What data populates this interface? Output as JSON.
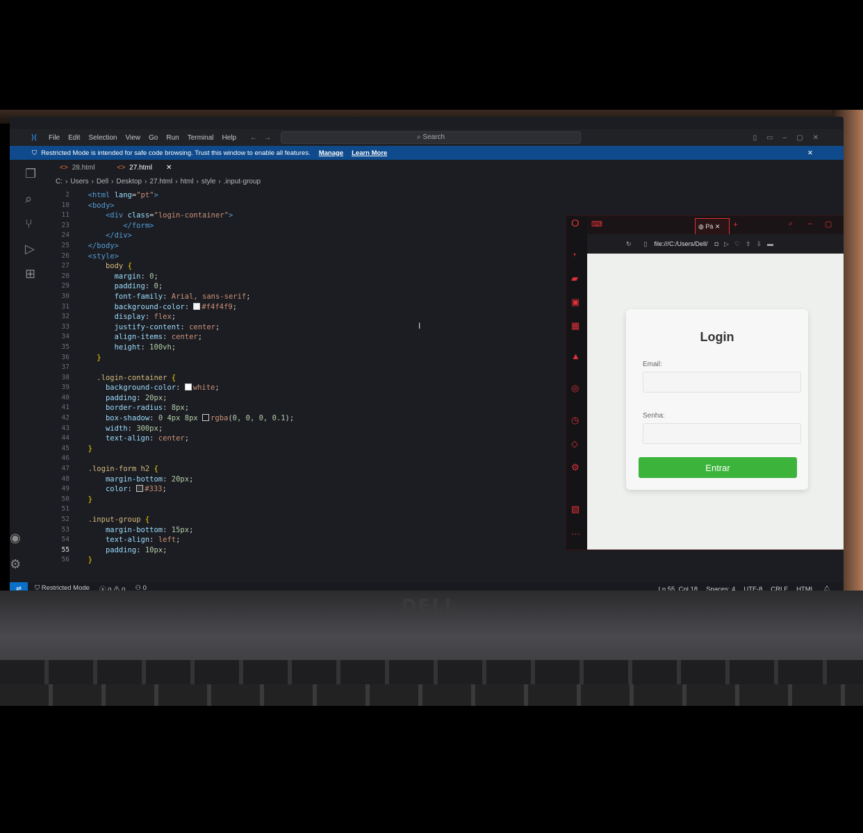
{
  "menu": [
    "File",
    "Edit",
    "Selection",
    "View",
    "Go",
    "Run",
    "Terminal",
    "Help"
  ],
  "search": {
    "label": "Search"
  },
  "banner": {
    "text": "Restricted Mode is intended for safe code browsing. Trust this window to enable all features.",
    "manage": "Manage",
    "learn_more": "Learn More"
  },
  "tabs": [
    {
      "label": "28.html",
      "active": false
    },
    {
      "label": "27.html",
      "active": true
    }
  ],
  "breadcrumb": [
    "C:",
    "Users",
    "Dell",
    "Desktop",
    "27.html",
    "html",
    "style",
    ".input-group"
  ],
  "code_lines": [
    {
      "n": "2",
      "html": "<span class='tok-txt'>  </span><span class='tok-tag'>&lt;html</span> <span class='tok-attr'>lang</span><span class='tok-txt'>=</span><span class='tok-str'>\"pt\"</span><span class='tok-tag'>&gt;</span>"
    },
    {
      "n": "10",
      "html": "<span class='tok-txt'>  </span><span class='tok-tag'>&lt;body&gt;</span>"
    },
    {
      "n": "11",
      "html": "<span class='tok-txt'>      </span><span class='tok-tag'>&lt;div</span> <span class='tok-attr'>class</span><span class='tok-txt'>=</span><span class='tok-str'>\"login-container\"</span><span class='tok-tag'>&gt;</span>"
    },
    {
      "n": "23",
      "html": "<span class='tok-txt'>          </span><span class='tok-tag'>&lt;/form&gt;</span>"
    },
    {
      "n": "24",
      "html": "<span class='tok-txt'>      </span><span class='tok-tag'>&lt;/div&gt;</span>"
    },
    {
      "n": "25",
      "html": "<span class='tok-txt'>  </span><span class='tok-tag'>&lt;/body&gt;</span>"
    },
    {
      "n": "26",
      "html": "<span class='tok-txt'>  </span><span class='tok-tag'>&lt;style&gt;</span>"
    },
    {
      "n": "27",
      "html": "<span class='tok-txt'>      </span><span class='tok-sel'>body</span> <span class='tok-brace'>{</span>"
    },
    {
      "n": "28",
      "html": "<span class='tok-txt'>        </span><span class='tok-prop'>margin</span><span class='tok-txt'>: </span><span class='tok-num'>0</span><span class='tok-txt'>;</span>"
    },
    {
      "n": "29",
      "html": "<span class='tok-txt'>        </span><span class='tok-prop'>padding</span><span class='tok-txt'>: </span><span class='tok-num'>0</span><span class='tok-txt'>;</span>"
    },
    {
      "n": "30",
      "html": "<span class='tok-txt'>        </span><span class='tok-prop'>font-family</span><span class='tok-txt'>: </span><span class='tok-val'>Arial, sans-serif</span><span class='tok-txt'>;</span>"
    },
    {
      "n": "31",
      "html": "<span class='tok-txt'>        </span><span class='tok-prop'>background-color</span><span class='tok-txt'>: </span><span class='sw' style='background:#f4f4f9'></span><span class='tok-val'>#f4f4f9</span><span class='tok-txt'>;</span>"
    },
    {
      "n": "32",
      "html": "<span class='tok-txt'>        </span><span class='tok-prop'>display</span><span class='tok-txt'>: </span><span class='tok-val'>flex</span><span class='tok-txt'>;</span>"
    },
    {
      "n": "33",
      "html": "<span class='tok-txt'>        </span><span class='tok-prop'>justify-content</span><span class='tok-txt'>: </span><span class='tok-val'>center</span><span class='tok-txt'>;</span>"
    },
    {
      "n": "34",
      "html": "<span class='tok-txt'>        </span><span class='tok-prop'>align-items</span><span class='tok-txt'>: </span><span class='tok-val'>center</span><span class='tok-txt'>;</span>"
    },
    {
      "n": "35",
      "html": "<span class='tok-txt'>        </span><span class='tok-prop'>height</span><span class='tok-txt'>: </span><span class='tok-num'>100vh</span><span class='tok-txt'>;</span>"
    },
    {
      "n": "36",
      "html": "<span class='tok-txt'>    </span><span class='tok-brace'>}</span>"
    },
    {
      "n": "37",
      "html": ""
    },
    {
      "n": "38",
      "html": "<span class='tok-txt'>    </span><span class='tok-sel'>.login-container</span> <span class='tok-brace'>{</span>"
    },
    {
      "n": "39",
      "html": "<span class='tok-txt'>      </span><span class='tok-prop'>background-color</span><span class='tok-txt'>: </span><span class='sw' style='background:#fff'></span><span class='tok-val'>white</span><span class='tok-txt'>;</span>"
    },
    {
      "n": "40",
      "html": "<span class='tok-txt'>      </span><span class='tok-prop'>padding</span><span class='tok-txt'>: </span><span class='tok-num'>20px</span><span class='tok-txt'>;</span>"
    },
    {
      "n": "41",
      "html": "<span class='tok-txt'>      </span><span class='tok-prop'>border-radius</span><span class='tok-txt'>: </span><span class='tok-num'>8px</span><span class='tok-txt'>;</span>"
    },
    {
      "n": "42",
      "html": "<span class='tok-txt'>      </span><span class='tok-prop'>box-shadow</span><span class='tok-txt'>: </span><span class='tok-num'>0 4px 8px</span> <span class='sw' style='background:rgba(0,0,0,0.1)'></span><span class='tok-val'>rgba</span><span class='tok-txt'>(</span><span class='tok-num'>0, 0, 0, 0.1</span><span class='tok-txt'>);</span>"
    },
    {
      "n": "43",
      "html": "<span class='tok-txt'>      </span><span class='tok-prop'>width</span><span class='tok-txt'>: </span><span class='tok-num'>300px</span><span class='tok-txt'>;</span>"
    },
    {
      "n": "44",
      "html": "<span class='tok-txt'>      </span><span class='tok-prop'>text-align</span><span class='tok-txt'>: </span><span class='tok-val'>center</span><span class='tok-txt'>;</span>"
    },
    {
      "n": "45",
      "html": "<span class='tok-txt'>  </span><span class='tok-brace'>}</span>"
    },
    {
      "n": "46",
      "html": ""
    },
    {
      "n": "47",
      "html": "<span class='tok-txt'>  </span><span class='tok-sel'>.login-form h2</span> <span class='tok-brace'>{</span>"
    },
    {
      "n": "48",
      "html": "<span class='tok-txt'>      </span><span class='tok-prop'>margin-bottom</span><span class='tok-txt'>: </span><span class='tok-num'>20px</span><span class='tok-txt'>;</span>"
    },
    {
      "n": "49",
      "html": "<span class='tok-txt'>      </span><span class='tok-prop'>color</span><span class='tok-txt'>: </span><span class='sw' style='background:#333'></span><span class='tok-val'>#333</span><span class='tok-txt'>;</span>"
    },
    {
      "n": "50",
      "html": "<span class='tok-txt'>  </span><span class='tok-brace'>}</span>"
    },
    {
      "n": "51",
      "html": ""
    },
    {
      "n": "52",
      "html": "<span class='tok-txt'>  </span><span class='tok-sel'>.input-group</span> <span class='tok-brace'>{</span>"
    },
    {
      "n": "53",
      "html": "<span class='tok-txt'>      </span><span class='tok-prop'>margin-bottom</span><span class='tok-txt'>: </span><span class='tok-num'>15px</span><span class='tok-txt'>;</span>"
    },
    {
      "n": "54",
      "html": "<span class='tok-txt'>      </span><span class='tok-prop'>text-align</span><span class='tok-txt'>: </span><span class='tok-val'>left</span><span class='tok-txt'>;</span>"
    },
    {
      "n": "55",
      "html": "<span class='tok-txt'>      </span><span class='tok-prop'>padding</span><span class='tok-txt'>: </span><span class='tok-num'>10px</span><span class='tok-txt'>;</span>",
      "current": true
    },
    {
      "n": "56",
      "html": "<span class='tok-txt'>  </span><span class='tok-brace'>}</span>"
    }
  ],
  "status": {
    "mode": "Restricted Mode",
    "problems": "ⓧ 0 ⚠ 0",
    "ports": "0",
    "position": "Ln 55, Col 18",
    "spaces": "Spaces: 4",
    "encoding": "UTF-8",
    "eol": "CRLF",
    "language": "HTML"
  },
  "browser": {
    "tab_label": "Pá",
    "address": "file:///C:/Users/Dell/",
    "page": {
      "title": "Login",
      "email_label": "Email:",
      "password_label": "Senha:",
      "submit": "Entrar"
    }
  },
  "colors": {
    "accent": "#0a6fc7",
    "banner": "#0e4a8c",
    "opera": "#e0303a",
    "submit": "#3cb43c"
  }
}
